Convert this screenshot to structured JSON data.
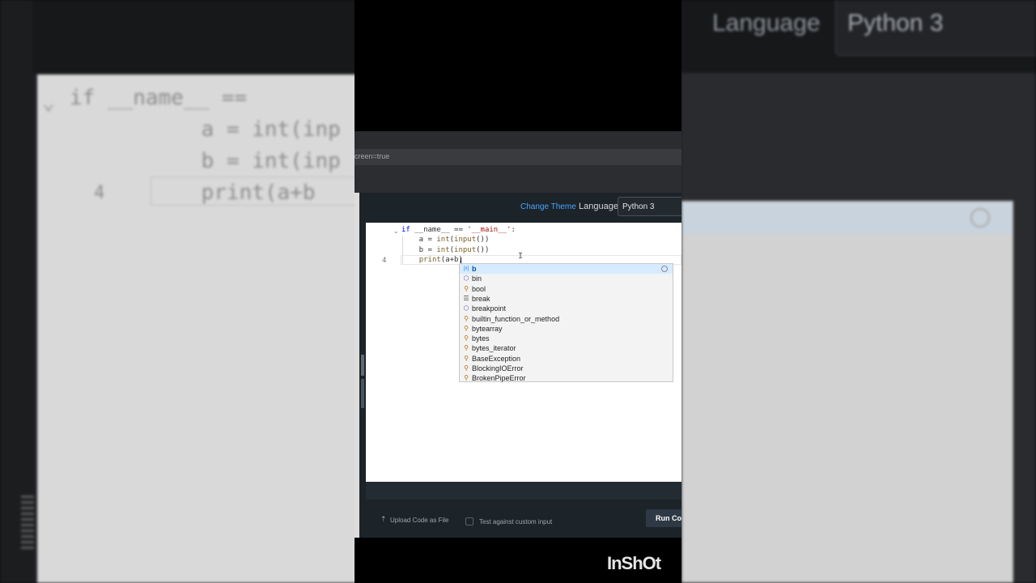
{
  "header": {
    "change_theme": "Change Theme",
    "language_label": "Language",
    "language_value": "Python 3",
    "url_fragment": "creen=true"
  },
  "editor": {
    "line_number": "4",
    "lines": [
      {
        "segments": [
          {
            "t": "if",
            "c": "kw"
          },
          {
            "t": " __name__ == ",
            "c": ""
          },
          {
            "t": "'__main__'",
            "c": "str"
          },
          {
            "t": ":",
            "c": ""
          }
        ]
      },
      {
        "segments": [
          {
            "t": "    a = ",
            "c": ""
          },
          {
            "t": "int",
            "c": "fn"
          },
          {
            "t": "(",
            "c": ""
          },
          {
            "t": "input",
            "c": "fn"
          },
          {
            "t": "())",
            "c": ""
          }
        ]
      },
      {
        "segments": [
          {
            "t": "    b = ",
            "c": ""
          },
          {
            "t": "int",
            "c": "fn"
          },
          {
            "t": "(",
            "c": ""
          },
          {
            "t": "input",
            "c": "fn"
          },
          {
            "t": "())",
            "c": ""
          }
        ]
      },
      {
        "segments": [
          {
            "t": "    ",
            "c": ""
          },
          {
            "t": "print",
            "c": "fn"
          },
          {
            "t": "(a+b)",
            "c": ""
          }
        ]
      }
    ]
  },
  "suggestions": [
    {
      "label": "b",
      "icon": "variable-icon",
      "selected": true
    },
    {
      "label": "bin",
      "icon": "module-icon"
    },
    {
      "label": "bool",
      "icon": "class-icon"
    },
    {
      "label": "break",
      "icon": "keyword-icon"
    },
    {
      "label": "breakpoint",
      "icon": "module-icon"
    },
    {
      "label": "builtin_function_or_method",
      "icon": "class-icon"
    },
    {
      "label": "bytearray",
      "icon": "class-icon"
    },
    {
      "label": "bytes",
      "icon": "class-icon"
    },
    {
      "label": "bytes_iterator",
      "icon": "class-icon"
    },
    {
      "label": "BaseException",
      "icon": "class-icon"
    },
    {
      "label": "BlockingIOError",
      "icon": "class-icon"
    },
    {
      "label": "BrokenPipeError",
      "icon": "class-icon"
    }
  ],
  "footer": {
    "upload_label": "Upload Code as File",
    "custom_input_label": "Test against custom input",
    "run_label": "Run Co"
  },
  "watermark": "InShOt",
  "background": {
    "language_label": "Language",
    "language_value": "Python 3",
    "line_number": "4",
    "code_line_1": "if __name__ ==",
    "code_line_2": "    a = int(inp",
    "code_line_3": "    b = int(inp",
    "code_line_4": "    print(a+b"
  },
  "colors": {
    "accent_link": "#47a6ff",
    "ide_background": "#1c2329",
    "suggestion_selected": "#d6ebff"
  }
}
